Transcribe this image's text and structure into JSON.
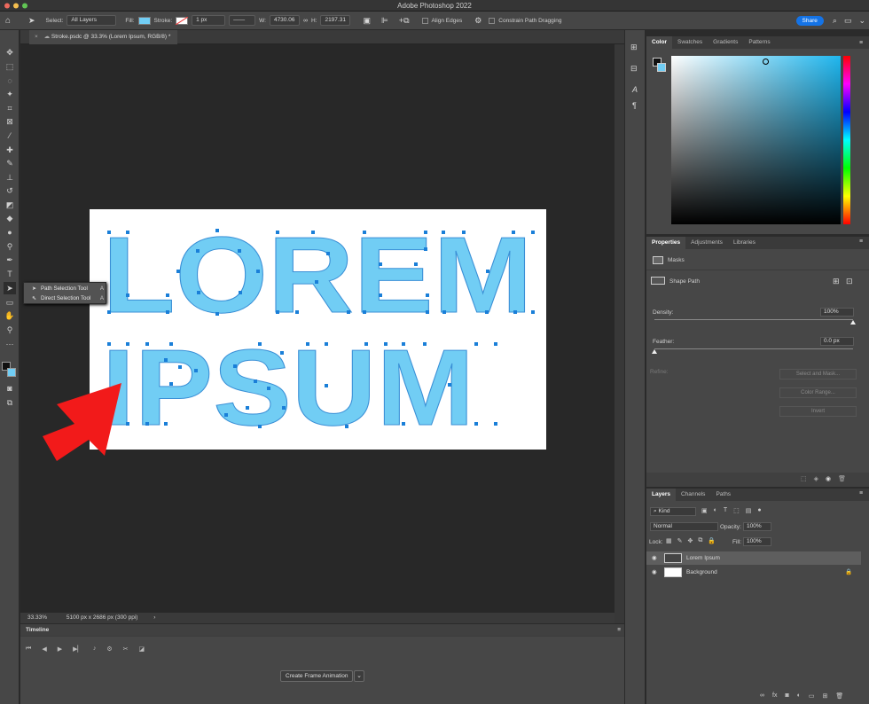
{
  "window": {
    "title": "Adobe Photoshop 2022"
  },
  "options_bar": {
    "select_label": "Select:",
    "select_value": "All Layers",
    "fill_label": "Fill:",
    "stroke_label": "Stroke:",
    "stroke_width": "1 px",
    "w_label": "W:",
    "w_value": "4730.06",
    "h_label": "H:",
    "h_value": "2197.31",
    "align_edges": "Align Edges",
    "constrain": "Constrain Path Dragging",
    "share_label": "Share",
    "fill_color": "#71cdf4"
  },
  "document": {
    "tab_title": "Stroke.psdc @ 33.3% (Lorem  Ipsum, RGB/8) *",
    "line1": "LOREM",
    "line2": "IPSUM",
    "text_color": "#71cdf4",
    "zoom": "33.33%",
    "dimensions": "5100 px x 2686 px (300 ppi)"
  },
  "flyout": {
    "items": [
      {
        "label": "Path Selection Tool",
        "key": "A"
      },
      {
        "label": "Direct Selection Tool",
        "key": "A"
      }
    ]
  },
  "timeline": {
    "title": "Timeline",
    "create_label": "Create Frame Animation"
  },
  "color_panel": {
    "tabs": [
      "Color",
      "Swatches",
      "Gradients",
      "Patterns"
    ],
    "hue_color": "#1fb6ee"
  },
  "properties_panel": {
    "tabs": [
      "Properties",
      "Adjustments",
      "Libraries"
    ],
    "masks_label": "Masks",
    "shape_path_label": "Shape Path",
    "density_label": "Density:",
    "density_value": "100%",
    "density_fraction": 1.0,
    "feather_label": "Feather:",
    "feather_value": "0.0 px",
    "feather_fraction": 0.0,
    "refine_label": "Refine:",
    "select_mask_label": "Select and Mask...",
    "color_range_label": "Color Range...",
    "invert_label": "Invert"
  },
  "layers_panel": {
    "tabs": [
      "Layers",
      "Channels",
      "Paths"
    ],
    "kind_label": "Kind",
    "blend_mode": "Normal",
    "opacity_label": "Opacity:",
    "opacity_value": "100%",
    "lock_label": "Lock:",
    "fill_label": "Fill:",
    "fill_value": "100%",
    "layers": [
      {
        "name": "Lorem  Ipsum",
        "selected": true
      },
      {
        "name": "Background",
        "selected": false
      }
    ]
  }
}
